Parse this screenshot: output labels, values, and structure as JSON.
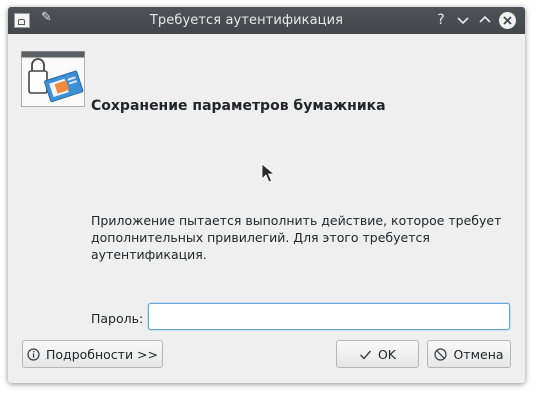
{
  "window": {
    "title": "Требуется аутентификация",
    "controls": {
      "help": "?",
      "minimize": "⌄",
      "maximize": "⌃",
      "close": "✕"
    }
  },
  "dialog": {
    "heading": "Сохранение параметров бумажника",
    "message": "Приложение пытается выполнить действие, которое требует дополнительных привилегий. Для этого требуется аутентификация.",
    "password_label": "Пароль:",
    "password_value": ""
  },
  "buttons": {
    "details": "Подробности >>",
    "ok": "OK",
    "cancel": "Отмена"
  },
  "icons": {
    "app": "lock-document-icon",
    "details": "info-icon",
    "ok": "checkmark-icon",
    "cancel": "cancel-icon"
  },
  "colors": {
    "titlebar": "#43474b",
    "window_bg": "#efefef",
    "focus_border": "#6aa6d6"
  }
}
